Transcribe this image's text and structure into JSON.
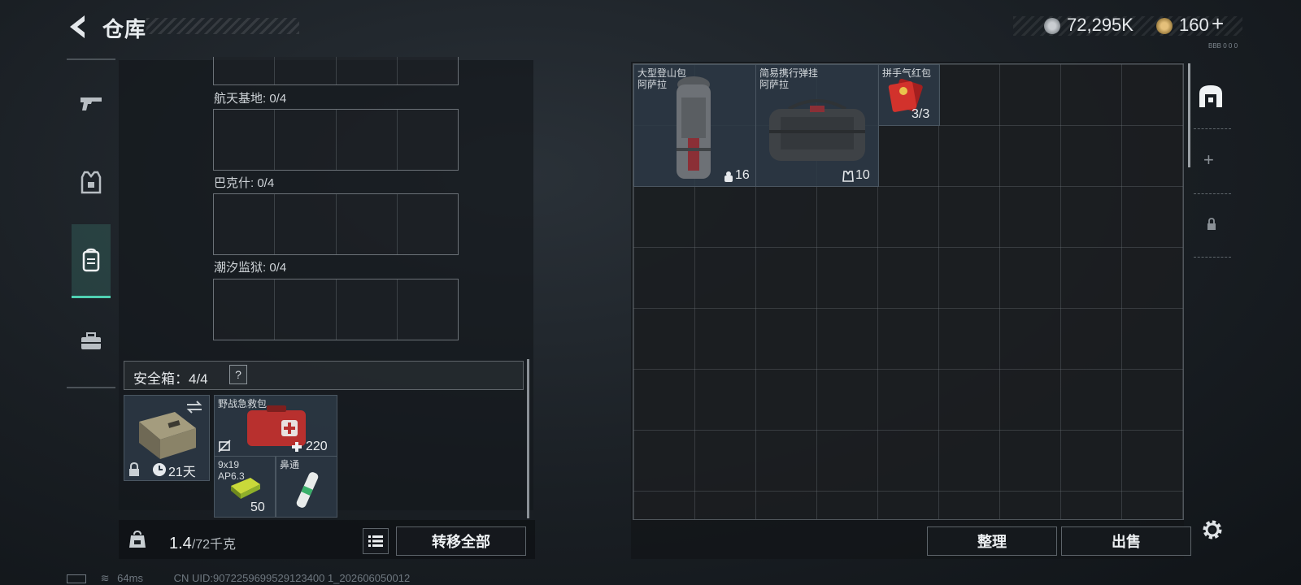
{
  "header": {
    "title": "仓库",
    "currency_1": "72,295K",
    "currency_2": "160",
    "currency_2_plus": "+",
    "tiny_code": "BBB 0 0 0"
  },
  "nav": {
    "items": [
      "weapon",
      "gear",
      "backpack",
      "toolbox"
    ],
    "active": "backpack"
  },
  "maps": [
    {
      "label": "航天基地: 0/4"
    },
    {
      "label": "巴克什: 0/4"
    },
    {
      "label": "潮汐监狱: 0/4"
    }
  ],
  "safebox": {
    "label": "安全箱：4/4",
    "help": "?",
    "duration": "21天",
    "items": [
      {
        "name": "野战急救包",
        "count": "220"
      },
      {
        "name": "9x19 AP6.3",
        "name_line1": "9x19",
        "name_line2": "AP6.3",
        "count": "50"
      },
      {
        "name": "鼻通",
        "count": ""
      }
    ]
  },
  "weight": {
    "current": "1.4",
    "max": "/72千克"
  },
  "buttons": {
    "transfer_all": "转移全部",
    "organize": "整理",
    "sell": "出售"
  },
  "storage_items": [
    {
      "name": "大型登山包",
      "sub": "阿萨拉",
      "count": "16"
    },
    {
      "name": "简易携行弹挂",
      "sub": "阿萨拉",
      "count": "10"
    },
    {
      "name": "拼手气红包",
      "sub": "",
      "count": "3/3"
    }
  ],
  "footer": {
    "ping": "64ms",
    "uid": "CN UID:9072259699529123400 1_202606050012"
  },
  "colors": {
    "accent": "#4fd1b2",
    "item_bg": "#2d3a46",
    "red_kit": "#c03030"
  }
}
